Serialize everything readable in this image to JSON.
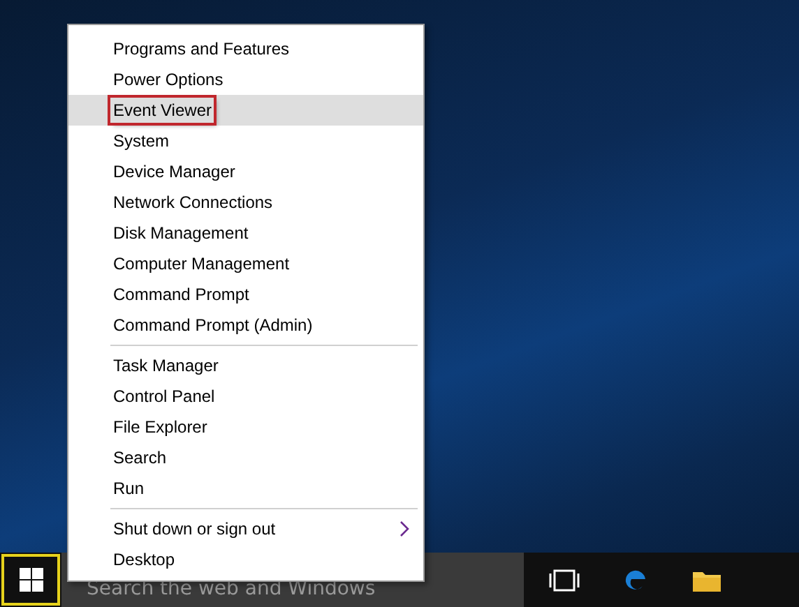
{
  "context_menu": {
    "sections": [
      {
        "items": [
          {
            "label": "Programs and Features",
            "selected": false,
            "annotated": false,
            "submenu": false
          },
          {
            "label": "Power Options",
            "selected": false,
            "annotated": false,
            "submenu": false
          },
          {
            "label": "Event Viewer",
            "selected": true,
            "annotated": true,
            "submenu": false
          },
          {
            "label": "System",
            "selected": false,
            "annotated": false,
            "submenu": false
          },
          {
            "label": "Device Manager",
            "selected": false,
            "annotated": false,
            "submenu": false
          },
          {
            "label": "Network Connections",
            "selected": false,
            "annotated": false,
            "submenu": false
          },
          {
            "label": "Disk Management",
            "selected": false,
            "annotated": false,
            "submenu": false
          },
          {
            "label": "Computer Management",
            "selected": false,
            "annotated": false,
            "submenu": false
          },
          {
            "label": "Command Prompt",
            "selected": false,
            "annotated": false,
            "submenu": false
          },
          {
            "label": "Command Prompt (Admin)",
            "selected": false,
            "annotated": false,
            "submenu": false
          }
        ]
      },
      {
        "items": [
          {
            "label": "Task Manager",
            "selected": false,
            "annotated": false,
            "submenu": false
          },
          {
            "label": "Control Panel",
            "selected": false,
            "annotated": false,
            "submenu": false
          },
          {
            "label": "File Explorer",
            "selected": false,
            "annotated": false,
            "submenu": false
          },
          {
            "label": "Search",
            "selected": false,
            "annotated": false,
            "submenu": false
          },
          {
            "label": "Run",
            "selected": false,
            "annotated": false,
            "submenu": false
          }
        ]
      },
      {
        "items": [
          {
            "label": "Shut down or sign out",
            "selected": false,
            "annotated": false,
            "submenu": true
          },
          {
            "label": "Desktop",
            "selected": false,
            "annotated": false,
            "submenu": false
          }
        ]
      }
    ]
  },
  "taskbar": {
    "start_focused": true,
    "search": {
      "placeholder": "Search the web and Windows"
    }
  }
}
